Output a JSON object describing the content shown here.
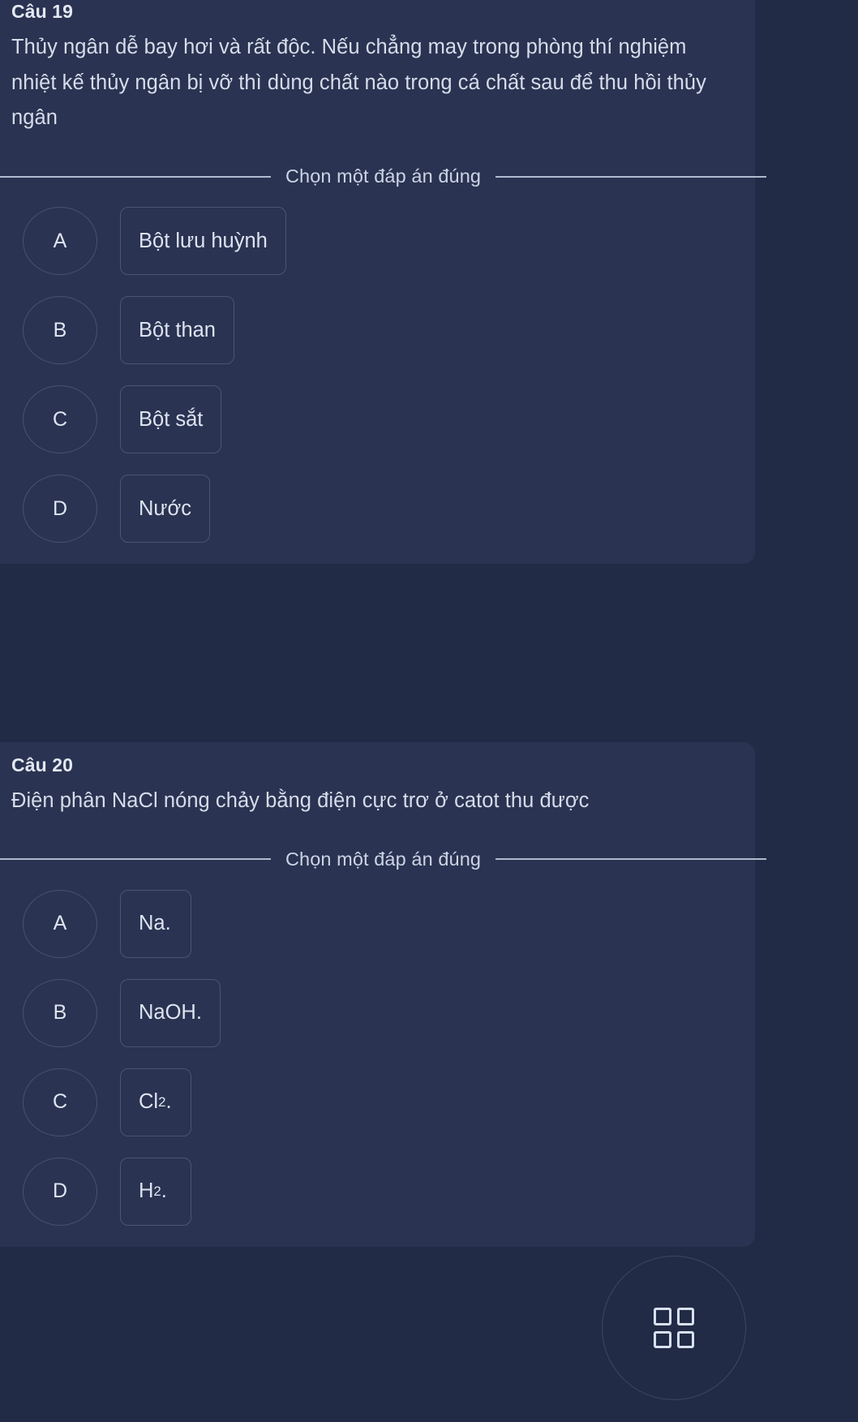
{
  "theme": {
    "page_bg": "#222b45",
    "card_bg": "#2a3351",
    "text_primary": "#d6dcea",
    "text_muted": "#ccd4e5",
    "outline": "#d1dbee"
  },
  "questions": [
    {
      "number_label": "Câu 19",
      "text": "Thủy ngân dễ bay hơi và rất độc. Nếu chẳng may trong phòng thí nghiệm nhiệt kế thủy ngân bị vỡ thì dùng chất nào trong cá chất sau để thu hồi thủy ngân",
      "choose_label": "Chọn một đáp án đúng",
      "options": [
        {
          "letter": "A",
          "label": "Bột lưu huỳnh"
        },
        {
          "letter": "B",
          "label": "Bột than"
        },
        {
          "letter": "C",
          "label": "Bột sắt"
        },
        {
          "letter": "D",
          "label": "Nước"
        }
      ]
    },
    {
      "number_label": "Câu 20",
      "text": "Điện phân NaCl nóng chảy bằng điện cực trơ ở catot thu được",
      "choose_label": "Chọn một đáp án đúng",
      "options": [
        {
          "letter": "A",
          "label": "Na.",
          "html": "Na."
        },
        {
          "letter": "B",
          "label": "NaOH.",
          "html": "NaOH."
        },
        {
          "letter": "C",
          "label": "Cl2.",
          "html": "Cl<sub>2</sub>."
        },
        {
          "letter": "D",
          "label": "H2.",
          "html": "H<sub>2</sub>."
        }
      ]
    }
  ],
  "fab": {
    "icon": "grid-icon"
  }
}
